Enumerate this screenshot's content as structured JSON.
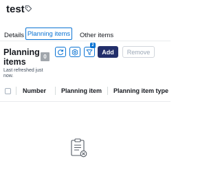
{
  "page": {
    "title": "test",
    "title_icon": "tag-icon"
  },
  "tabs": [
    {
      "label": "Details",
      "active": false
    },
    {
      "label": "Planning items",
      "active": true
    },
    {
      "label": "Other items",
      "active": false
    }
  ],
  "section": {
    "heading": "Planning items",
    "count": "0",
    "last_refreshed": "Last refreshed just now."
  },
  "toolbar": {
    "refresh_icon": "refresh-icon",
    "settings_icon": "settings-icon",
    "filter_icon": "filter-icon",
    "filter_count": "2",
    "add_label": "Add",
    "remove_label": "Remove"
  },
  "table": {
    "columns": [
      "Number",
      "Planning item",
      "Planning item type"
    ]
  },
  "empty_state": {
    "icon": "clipboard-empty-icon"
  },
  "colors": {
    "accent": "#0972d3",
    "primary_button": "#232f6b",
    "badge": "#a1a6ac"
  }
}
